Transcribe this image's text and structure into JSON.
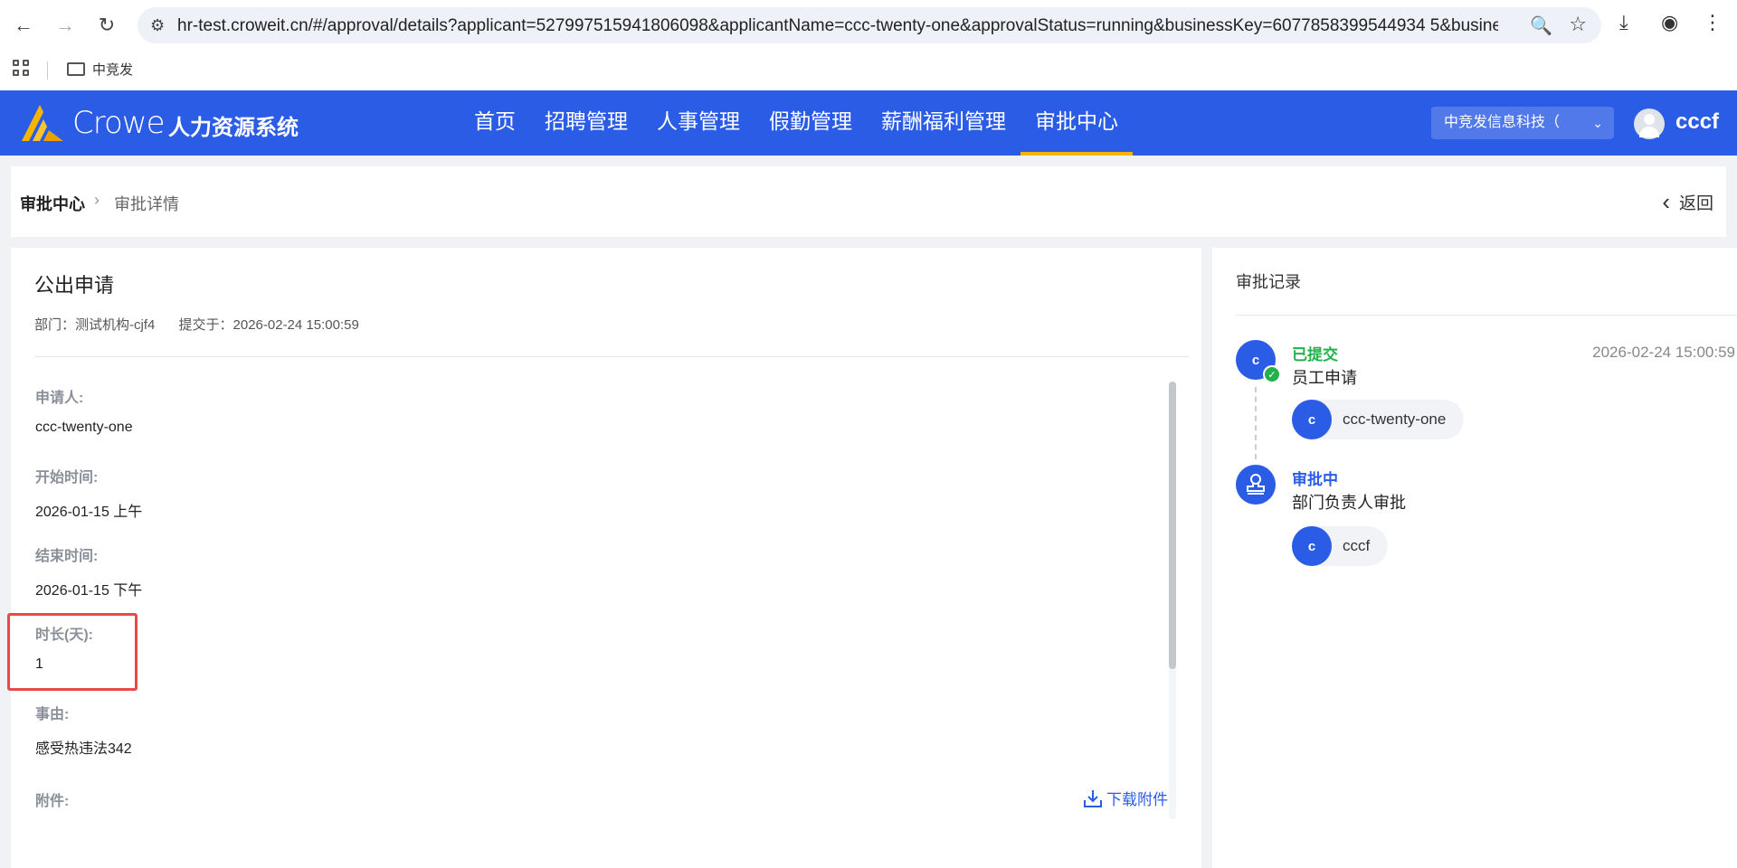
{
  "browser": {
    "url": "hr-test.croweit.cn/#/approval/details?applicant=527997515941806098&applicantName=ccc-twenty-one&approvalStatus=running&businessKey=6077858399544934 5&busine..."
  },
  "bookmarks": {
    "folder_label": "中竞发"
  },
  "header": {
    "brand": "Crowe",
    "system_name": "人力资源系统",
    "nav": [
      "首页",
      "招聘管理",
      "人事管理",
      "假勤管理",
      "薪酬福利管理",
      "审批中心"
    ],
    "active_nav": "审批中心",
    "company": "中竞发信息科技（",
    "user": "cccf",
    "accent_color": "#2b5ce6",
    "active_underline_color": "#f5b400"
  },
  "breadcrumb": {
    "root": "审批中心",
    "current": "审批详情",
    "back": "返回"
  },
  "detail": {
    "title": "公出申请",
    "department": "部门：测试机构-cjf4",
    "submitted": "提交于：2026-02-24 15:00:59",
    "fields": [
      {
        "label": "申请人:",
        "value": "ccc-twenty-one"
      },
      {
        "label": "开始时间:",
        "value": "2026-01-15 上午"
      },
      {
        "label": "结束时间:",
        "value": "2026-01-15 下午"
      },
      {
        "label": "时长(天):",
        "value": "1"
      },
      {
        "label": "事由:",
        "value": "感受热违法342"
      },
      {
        "label": "附件:",
        "value": ""
      }
    ],
    "download_label": "下载附件"
  },
  "records": {
    "title": "审批记录",
    "items": [
      {
        "status": "已提交",
        "status_color": "#22b14c",
        "step": "员工申请",
        "time": "2026-02-24 15:00:59",
        "node": "c",
        "person_initial": "c",
        "person": "ccc-twenty-one",
        "node_icon": "check-badge-icon"
      },
      {
        "status": "审批中",
        "status_color": "#2b5ce6",
        "step": "部门负责人审批",
        "time": "",
        "node": "",
        "person_initial": "c",
        "person": "cccf",
        "node_icon": "stamp-icon"
      }
    ]
  }
}
